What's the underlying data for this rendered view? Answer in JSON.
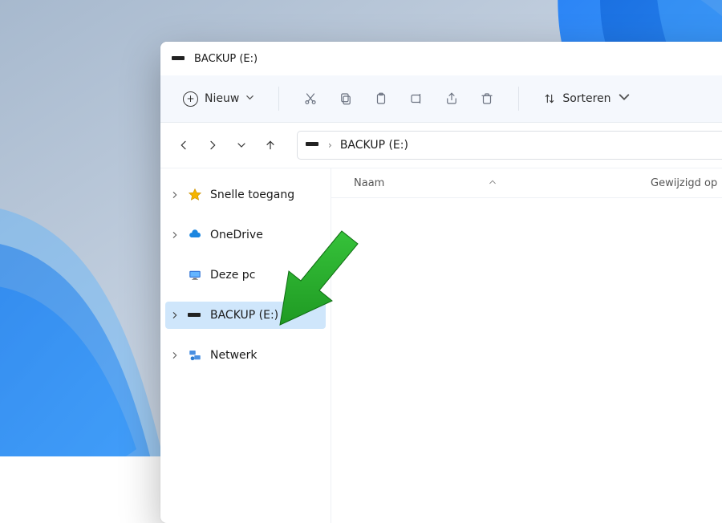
{
  "window": {
    "title": "BACKUP (E:)"
  },
  "toolbar": {
    "new_label": "Nieuw",
    "sort_label": "Sorteren"
  },
  "address": {
    "current": "BACKUP (E:)"
  },
  "sidebar": {
    "items": [
      {
        "label": "Snelle toegang",
        "icon": "star"
      },
      {
        "label": "OneDrive",
        "icon": "onedrive"
      },
      {
        "label": "Deze pc",
        "icon": "pc"
      },
      {
        "label": "BACKUP (E:)",
        "icon": "drive",
        "selected": true
      },
      {
        "label": "Netwerk",
        "icon": "network"
      }
    ]
  },
  "columns": {
    "name_header": "Naam",
    "modified_header": "Gewijzigd op"
  }
}
